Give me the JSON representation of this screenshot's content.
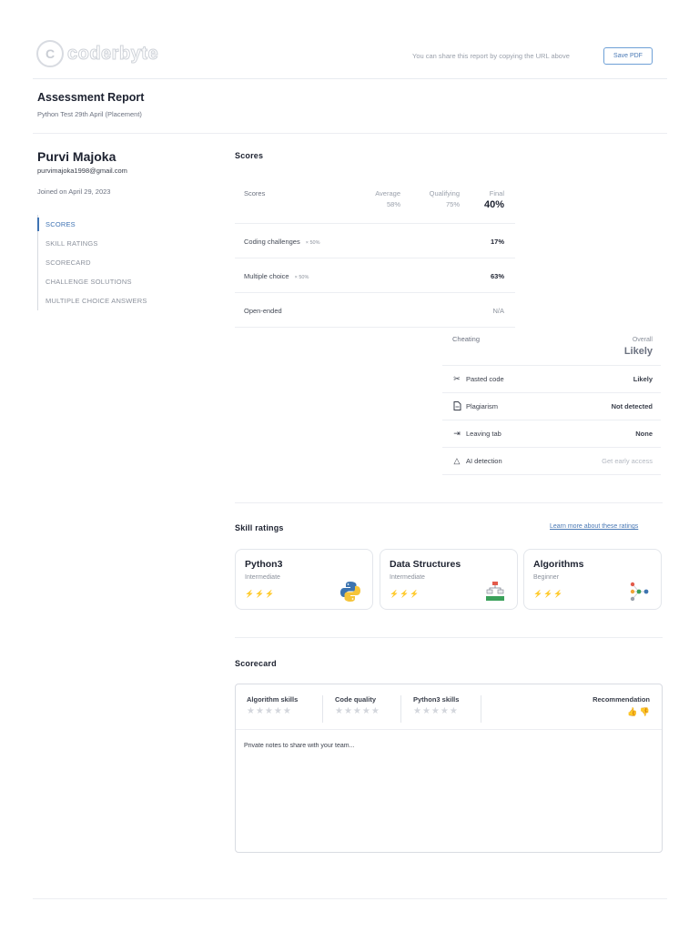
{
  "header": {
    "logo_text": "coderbyte",
    "share_text": "You can share this report by copying the URL above",
    "save_pdf_label": "Save PDF"
  },
  "report": {
    "title": "Assessment Report",
    "subtitle": "Python Test 29th April (Placement)"
  },
  "candidate": {
    "name": "Purvi Majoka",
    "email": "purvimajoka1998@gmail.com",
    "joined": "Joined on April 29, 2023"
  },
  "nav": {
    "items": [
      "SCORES",
      "SKILL RATINGS",
      "SCORECARD",
      "CHALLENGE SOLUTIONS",
      "MULTIPLE CHOICE ANSWERS"
    ]
  },
  "scores": {
    "section_title": "Scores",
    "header": {
      "label": "Scores",
      "average_label": "Average",
      "average_value": "58%",
      "qualifying_label": "Qualifying",
      "qualifying_value": "75%",
      "final_label": "Final",
      "final_value": "40%"
    },
    "rows": [
      {
        "label": "Coding challenges",
        "weight": "× 50%",
        "value": "17%"
      },
      {
        "label": "Multiple choice",
        "weight": "× 50%",
        "value": "63%"
      },
      {
        "label": "Open-ended",
        "weight": "",
        "value": "N/A"
      }
    ]
  },
  "cheating": {
    "label": "Cheating",
    "overall_label": "Overall",
    "overall_value": "Likely",
    "rows": [
      {
        "icon": "scissors-icon",
        "label": "Pasted code",
        "value": "Likely"
      },
      {
        "icon": "document-icon",
        "label": "Plagiarism",
        "value": "Not detected"
      },
      {
        "icon": "exit-arrow-icon",
        "label": "Leaving tab",
        "value": "None"
      },
      {
        "icon": "warning-triangle-icon",
        "label": "AI detection",
        "value": "Get early access"
      }
    ]
  },
  "skills": {
    "section_title": "Skill ratings",
    "learn_more": "Learn more about these ratings",
    "cards": [
      {
        "title": "Python3",
        "level": "Intermediate",
        "bolts_filled": 2,
        "bolts_total": 3,
        "icon": "python-logo-icon"
      },
      {
        "title": "Data Structures",
        "level": "Intermediate",
        "bolts_filled": 2,
        "bolts_total": 3,
        "icon": "data-structure-icon"
      },
      {
        "title": "Algorithms",
        "level": "Beginner",
        "bolts_filled": 1,
        "bolts_total": 3,
        "icon": "algorithm-graph-icon"
      }
    ]
  },
  "scorecard": {
    "section_title": "Scorecard",
    "columns": [
      "Algorithm skills",
      "Code quality",
      "Python3 skills"
    ],
    "recommendation_label": "Recommendation",
    "notes_placeholder": "Private notes to share with your team..."
  },
  "colors": {
    "accent": "#3f73b3",
    "bolt_on": "#f3c22c",
    "bolt_off": "#d3d6dc"
  }
}
